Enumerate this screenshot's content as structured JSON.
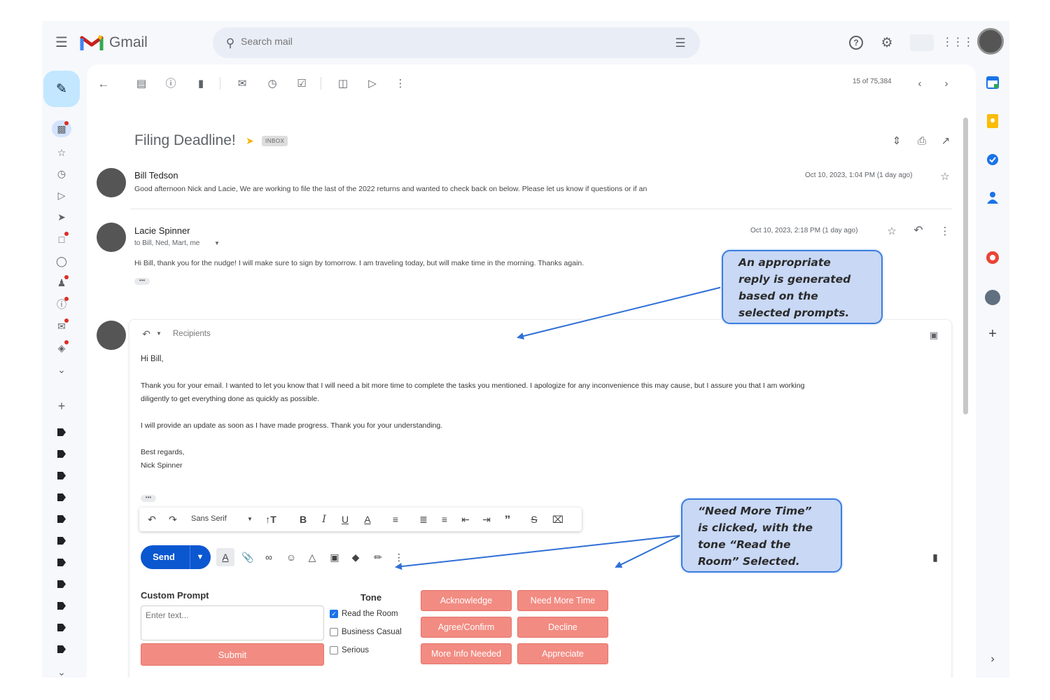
{
  "app": {
    "name": "Gmail"
  },
  "search": {
    "placeholder": "Search mail"
  },
  "thread": {
    "subject": "Filing Deadline!",
    "label_chip": "INBOX",
    "counter": "15 of 75,384",
    "messages": [
      {
        "sender": "Bill Tedson",
        "snippet": "Good afternoon Nick and Lacie, We are working to file the last of the 2022 returns and wanted to check back on below. Please let us know if questions or if an",
        "date": "Oct 10, 2023, 1:04 PM (1 day ago)"
      },
      {
        "sender": "Lacie Spinner",
        "recipients": "to Bill, Ned, Mart, me",
        "body": "Hi Bill, thank you for the nudge! I will make sure to sign by tomorrow. I am traveling today, but will make time in the morning. Thanks again.",
        "date": "Oct 10, 2023, 2:18 PM (1 day ago)",
        "more": "•••"
      }
    ]
  },
  "reply": {
    "recipients_placeholder": "Recipients",
    "greeting": "Hi Bill,",
    "para1_line1": "Thank you for your email. I wanted to let you know that I will need a bit more time to complete the tasks you mentioned. I apologize for any inconvenience this may cause, but I assure you that I am working",
    "para1_line2": "diligently to get everything done as quickly as possible.",
    "para2": "I will provide an update as soon as I have made progress. Thank you for your understanding.",
    "signoff": "Best regards,",
    "signature": "Nick Spinner",
    "more": "•••",
    "font": "Sans Serif",
    "send_label": "Send"
  },
  "prompt_panel": {
    "custom_title": "Custom Prompt",
    "custom_placeholder": "Enter text...",
    "submit_label": "Submit",
    "tone_title": "Tone",
    "tones": [
      {
        "label": "Read the Room",
        "checked": true
      },
      {
        "label": "Business Casual",
        "checked": false
      },
      {
        "label": "Serious",
        "checked": false
      }
    ],
    "buttons": [
      "Acknowledge",
      "Need More Time",
      "Agree/Confirm",
      "Decline",
      "More Info Needed",
      "Appreciate"
    ]
  },
  "callouts": {
    "reply_generated": [
      "An appropriate",
      "reply is generated",
      "based on the",
      "selected prompts."
    ],
    "need_more_time": [
      "“Need More Time”",
      "is clicked, with the",
      "tone “Read the",
      "Room” Selected."
    ]
  },
  "colors": {
    "accent_send": "#0b57d0",
    "prompt_button": "#f28b82",
    "callout_fill": "#c8d8f5",
    "callout_border": "#3b7ddd",
    "compose_fill": "#c2e7ff"
  },
  "icons": {
    "menu": "menu-icon",
    "search": "search-icon",
    "filter": "filter-icon",
    "help": "help-icon",
    "settings": "gear-icon",
    "apps": "apps-grid-icon"
  }
}
